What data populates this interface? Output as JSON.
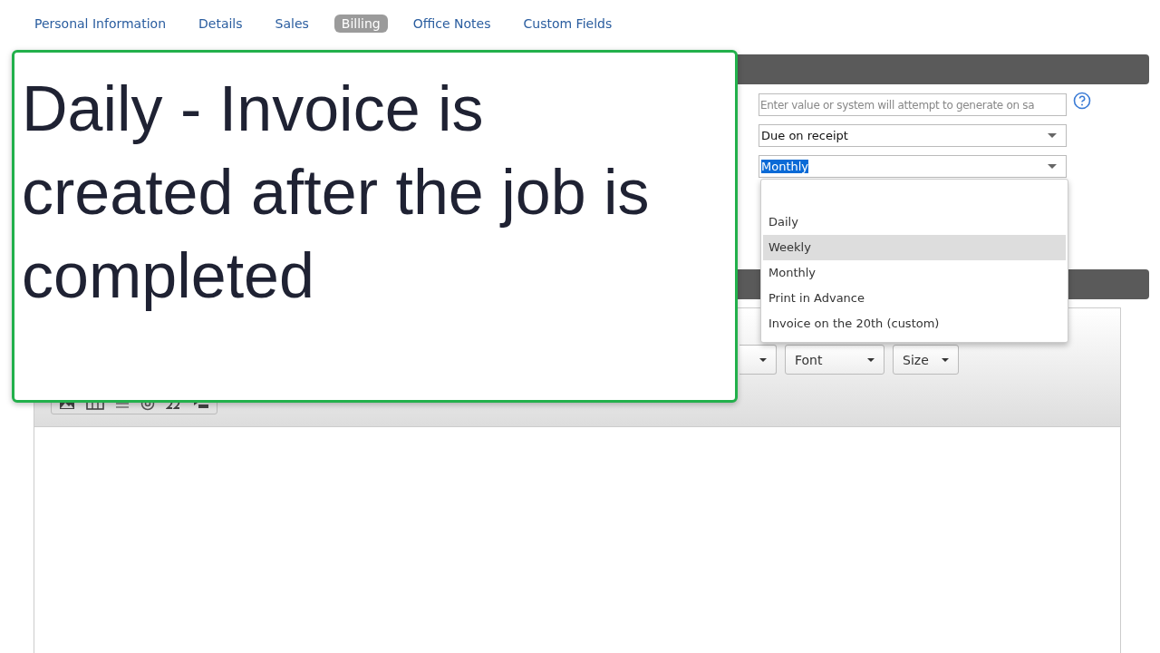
{
  "tabs": [
    {
      "label": "Personal Information",
      "selected": false
    },
    {
      "label": "Details",
      "selected": false
    },
    {
      "label": "Sales",
      "selected": false
    },
    {
      "label": "Billing",
      "selected": true
    },
    {
      "label": "Office Notes",
      "selected": false
    },
    {
      "label": "Custom Fields",
      "selected": false
    }
  ],
  "callout": {
    "text": "Daily - Invoice is created after the job is completed"
  },
  "fields": [
    {
      "kind": "text",
      "placeholder": "Enter value or system will attempt to generate on sa"
    },
    {
      "kind": "select",
      "value": "Due on receipt",
      "text_selected": false
    },
    {
      "kind": "select",
      "value": "Monthly",
      "text_selected": true
    }
  ],
  "dropdown": {
    "options": [
      {
        "label": "Daily",
        "selected": false
      },
      {
        "label": "Weekly",
        "selected": true
      },
      {
        "label": "Monthly",
        "selected": false
      },
      {
        "label": "Print in Advance",
        "selected": false
      },
      {
        "label": "Invoice on the 20th (custom)",
        "selected": false
      }
    ]
  },
  "editor": {
    "toolbar": [
      {
        "label": "Font"
      },
      {
        "label": "Size"
      }
    ]
  }
}
